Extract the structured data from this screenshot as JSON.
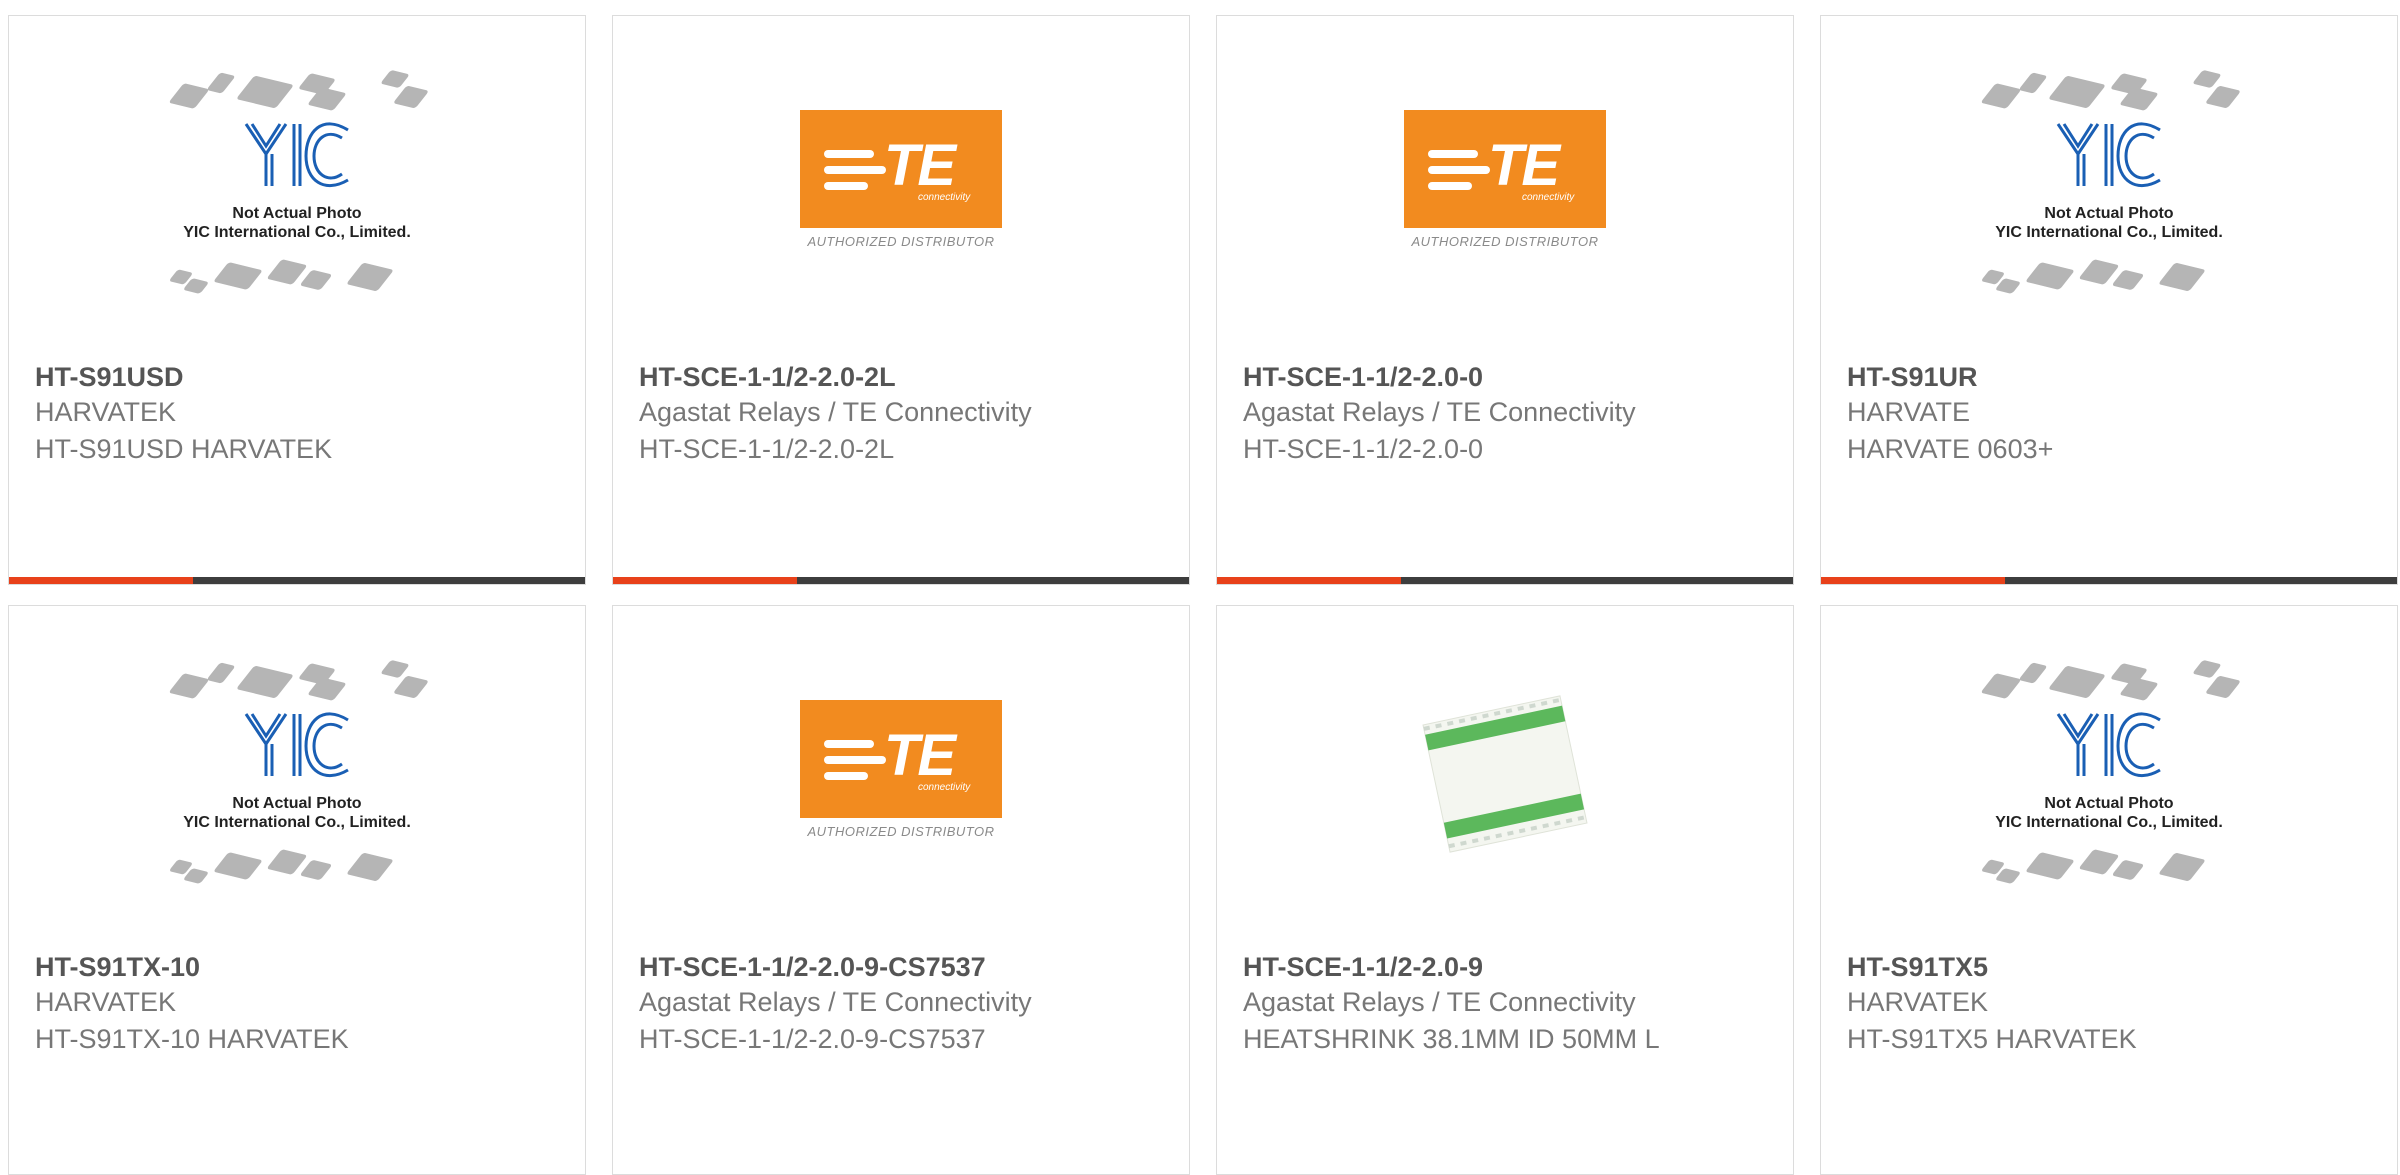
{
  "products": [
    {
      "part_number": "HT-S91USD",
      "manufacturer": "HARVATEK",
      "description": "HT-S91USD HARVATEK",
      "image": "yic-placeholder"
    },
    {
      "part_number": "HT-SCE-1-1/2-2.0-2L",
      "manufacturer": "Agastat Relays / TE Connectivity",
      "description": "HT-SCE-1-1/2-2.0-2L",
      "image": "te-logo"
    },
    {
      "part_number": "HT-SCE-1-1/2-2.0-0",
      "manufacturer": "Agastat Relays / TE Connectivity",
      "description": "HT-SCE-1-1/2-2.0-0",
      "image": "te-logo"
    },
    {
      "part_number": "HT-S91UR",
      "manufacturer": "HARVATE",
      "description": "HARVATE 0603+",
      "image": "yic-placeholder"
    },
    {
      "part_number": "HT-S91TX-10",
      "manufacturer": "HARVATEK",
      "description": "HT-S91TX-10 HARVATEK",
      "image": "yic-placeholder"
    },
    {
      "part_number": "HT-SCE-1-1/2-2.0-9-CS7537",
      "manufacturer": "Agastat Relays / TE Connectivity",
      "description": "HT-SCE-1-1/2-2.0-9-CS7537",
      "image": "te-logo"
    },
    {
      "part_number": "HT-SCE-1-1/2-2.0-9",
      "manufacturer": "Agastat Relays / TE Connectivity",
      "description": "HEATSHRINK 38.1MM ID 50MM L",
      "image": "heatshrink-photo"
    },
    {
      "part_number": "HT-S91TX5",
      "manufacturer": "HARVATEK",
      "description": "HT-S91TX5 HARVATEK",
      "image": "yic-placeholder"
    }
  ],
  "placeholder": {
    "line1": "Not Actual Photo",
    "line2": "YIC International Co., Limited.",
    "logo": "YIC"
  },
  "te_logo": {
    "word": "TE",
    "sub": "connectivity",
    "tag": "AUTHORIZED DISTRIBUTOR"
  },
  "colors": {
    "accent": "#e8411a",
    "bar": "#3d3d3d",
    "te_orange": "#f28b1f",
    "yic_blue": "#1a5fb4"
  }
}
